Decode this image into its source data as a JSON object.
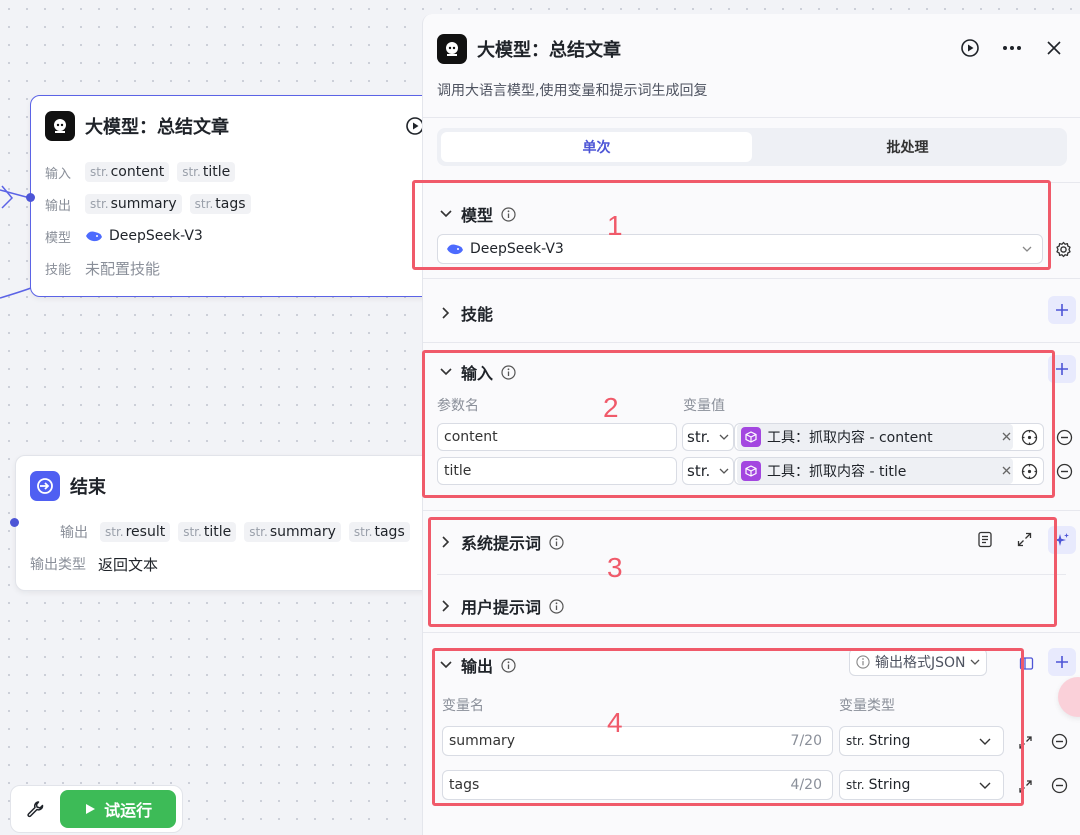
{
  "llm_node": {
    "title": "大模型：总结文章",
    "input_label": "输入",
    "inputs": [
      {
        "type": "str.",
        "name": "content"
      },
      {
        "type": "str.",
        "name": "title"
      }
    ],
    "output_label": "输出",
    "outputs": [
      {
        "type": "str.",
        "name": "summary"
      },
      {
        "type": "str.",
        "name": "tags"
      }
    ],
    "model_label": "模型",
    "model": "DeepSeek-V3",
    "skill_label": "技能",
    "skill_value": "未配置技能"
  },
  "end_node": {
    "title": "结束",
    "output_label": "输出",
    "outputs": [
      {
        "type": "str.",
        "name": "result"
      },
      {
        "type": "str.",
        "name": "title"
      },
      {
        "type": "str.",
        "name": "summary"
      },
      {
        "type": "str.",
        "name": "tags"
      }
    ],
    "output_type_label": "输出类型",
    "output_type_value": "返回文本"
  },
  "toolbar": {
    "trial_run": "试运行"
  },
  "panel": {
    "title": "大模型：总结文章",
    "description": "调用大语言模型,使用变量和提示词生成回复",
    "tabs": [
      {
        "label": "单次"
      },
      {
        "label": "批处理"
      }
    ],
    "model_section": {
      "title": "模型",
      "selected": "DeepSeek-V3"
    },
    "skills_section": {
      "title": "技能"
    },
    "input_section": {
      "title": "输入",
      "col_param": "参数名",
      "col_value": "变量值",
      "rows": [
        {
          "name": "content",
          "type": "str.",
          "ref": "工具：抓取内容 - content"
        },
        {
          "name": "title",
          "type": "str.",
          "ref": "工具：抓取内容 - title"
        }
      ]
    },
    "system_prompt": {
      "title": "系统提示词"
    },
    "user_prompt": {
      "title": "用户提示词"
    },
    "output_section": {
      "title": "输出",
      "format_button": "输出格式JSON",
      "col_name": "变量名",
      "col_type": "变量类型",
      "rows": [
        {
          "name": "summary",
          "count": "7/20",
          "type_prefix": "str.",
          "type": "String"
        },
        {
          "name": "tags",
          "count": "4/20",
          "type_prefix": "str.",
          "type": "String"
        }
      ]
    }
  },
  "annotations": [
    "1",
    "2",
    "3",
    "4"
  ],
  "colors": {
    "accent": "#4d55d6",
    "annotation": "#f05a6a",
    "run_green": "#3dbb57",
    "tool_purple": "#a347e0"
  }
}
